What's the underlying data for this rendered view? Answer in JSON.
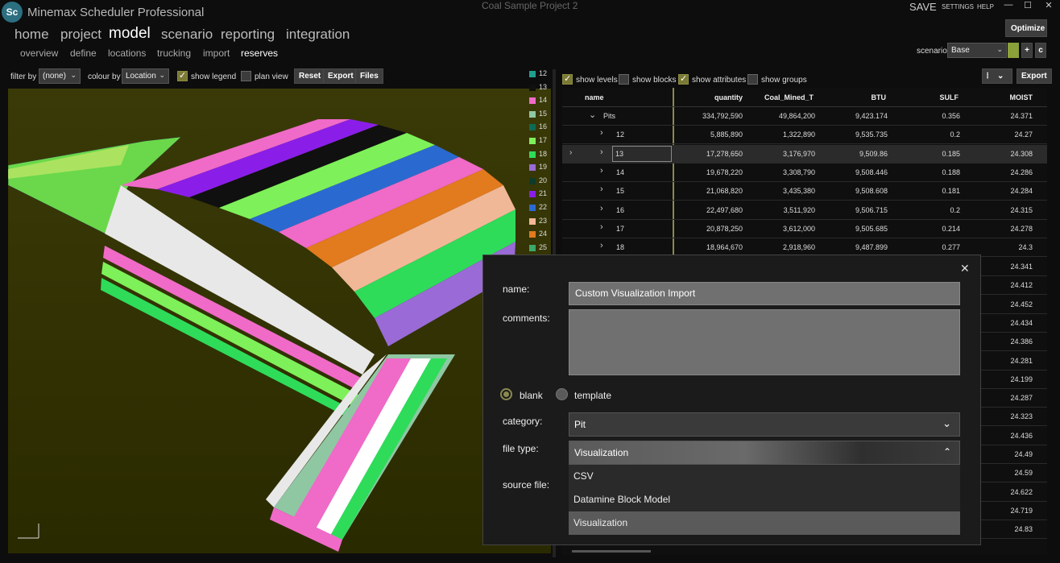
{
  "app": {
    "logo": "Sc",
    "title": "Minemax Scheduler Professional",
    "project": "Coal Sample Project 2",
    "save": "SAVE",
    "settings": "SETTINGS",
    "help": "HELP",
    "optimize": "Optimize",
    "window_buttons": [
      "—",
      "☐",
      "✕"
    ]
  },
  "nav": {
    "main": [
      "home",
      "project",
      "model",
      "scenario",
      "reporting",
      "integration"
    ],
    "active_main": "model",
    "sub": [
      "overview",
      "define",
      "locations",
      "trucking",
      "import",
      "reserves"
    ],
    "active_sub": "reserves"
  },
  "scenario": {
    "label": "scenario",
    "value": "Base",
    "plus": "+",
    "c": "c"
  },
  "left_toolbar": {
    "filter_label": "filter by",
    "filter_value": "(none)",
    "colour_label": "colour by",
    "colour_value": "Location",
    "show_legend": "show legend",
    "plan_view": "plan view",
    "reset": "Reset",
    "export": "Export",
    "files": "Files"
  },
  "legend": [
    {
      "label": "12",
      "color": "#1f9e8e"
    },
    {
      "label": "13",
      "color": "#101010"
    },
    {
      "label": "14",
      "color": "#f06ac8"
    },
    {
      "label": "15",
      "color": "#8fc7a3"
    },
    {
      "label": "16",
      "color": "#0d6b55"
    },
    {
      "label": "17",
      "color": "#7ef05a"
    },
    {
      "label": "18",
      "color": "#2edc5a"
    },
    {
      "label": "19",
      "color": "#9a6ad6"
    },
    {
      "label": "20",
      "color": "#0e3b2a"
    },
    {
      "label": "21",
      "color": "#8a1ee8"
    },
    {
      "label": "22",
      "color": "#2a6ad0"
    },
    {
      "label": "23",
      "color": "#f0b896"
    },
    {
      "label": "24",
      "color": "#e27a1e"
    },
    {
      "label": "25",
      "color": "#3ca86a"
    }
  ],
  "right_toolbar": {
    "show_levels": "show levels",
    "show_blocks": "show blocks",
    "show_attributes": "show attributes",
    "show_groups": "show groups",
    "export": "Export"
  },
  "table": {
    "columns": [
      "name",
      "quantity",
      "Coal_Mined_T",
      "BTU",
      "SULF",
      "MOIST"
    ],
    "rows": [
      {
        "name": "Pits",
        "quantity": "334,792,590",
        "coal": "49,864,200",
        "btu": "9,423.174",
        "sulf": "0.356",
        "moist": "24.371"
      },
      {
        "name": "12",
        "quantity": "5,885,890",
        "coal": "1,322,890",
        "btu": "9,535.735",
        "sulf": "0.2",
        "moist": "24.27"
      },
      {
        "name": "13",
        "quantity": "17,278,650",
        "coal": "3,176,970",
        "btu": "9,509.86",
        "sulf": "0.185",
        "moist": "24.308"
      },
      {
        "name": "14",
        "quantity": "19,678,220",
        "coal": "3,308,790",
        "btu": "9,508.446",
        "sulf": "0.188",
        "moist": "24.286"
      },
      {
        "name": "15",
        "quantity": "21,068,820",
        "coal": "3,435,380",
        "btu": "9,508.608",
        "sulf": "0.181",
        "moist": "24.284"
      },
      {
        "name": "16",
        "quantity": "22,497,680",
        "coal": "3,511,920",
        "btu": "9,506.715",
        "sulf": "0.2",
        "moist": "24.315"
      },
      {
        "name": "17",
        "quantity": "20,878,250",
        "coal": "3,612,000",
        "btu": "9,505.685",
        "sulf": "0.214",
        "moist": "24.278"
      },
      {
        "name": "18",
        "quantity": "18,964,670",
        "coal": "2,918,960",
        "btu": "9,487.899",
        "sulf": "0.277",
        "moist": "24.3"
      }
    ],
    "hidden_moist": [
      "24.341",
      "24.412",
      "24.452",
      "24.434",
      "24.386",
      "24.281",
      "24.199",
      "24.287",
      "24.323",
      "24.436",
      "24.49",
      "24.59",
      "24.622",
      "24.719",
      "24.83"
    ]
  },
  "dialog": {
    "close": "✕",
    "name_label": "name:",
    "name_value": "Custom Visualization Import",
    "comments_label": "comments:",
    "comments_value": "",
    "blank": "blank",
    "template": "template",
    "category_label": "category:",
    "category_value": "Pit",
    "filetype_label": "file type:",
    "filetype_value": "Visualization",
    "source_label": "source file:",
    "options": [
      "CSV",
      "Datamine Block Model",
      "Visualization"
    ],
    "selected_option": "Visualization"
  }
}
